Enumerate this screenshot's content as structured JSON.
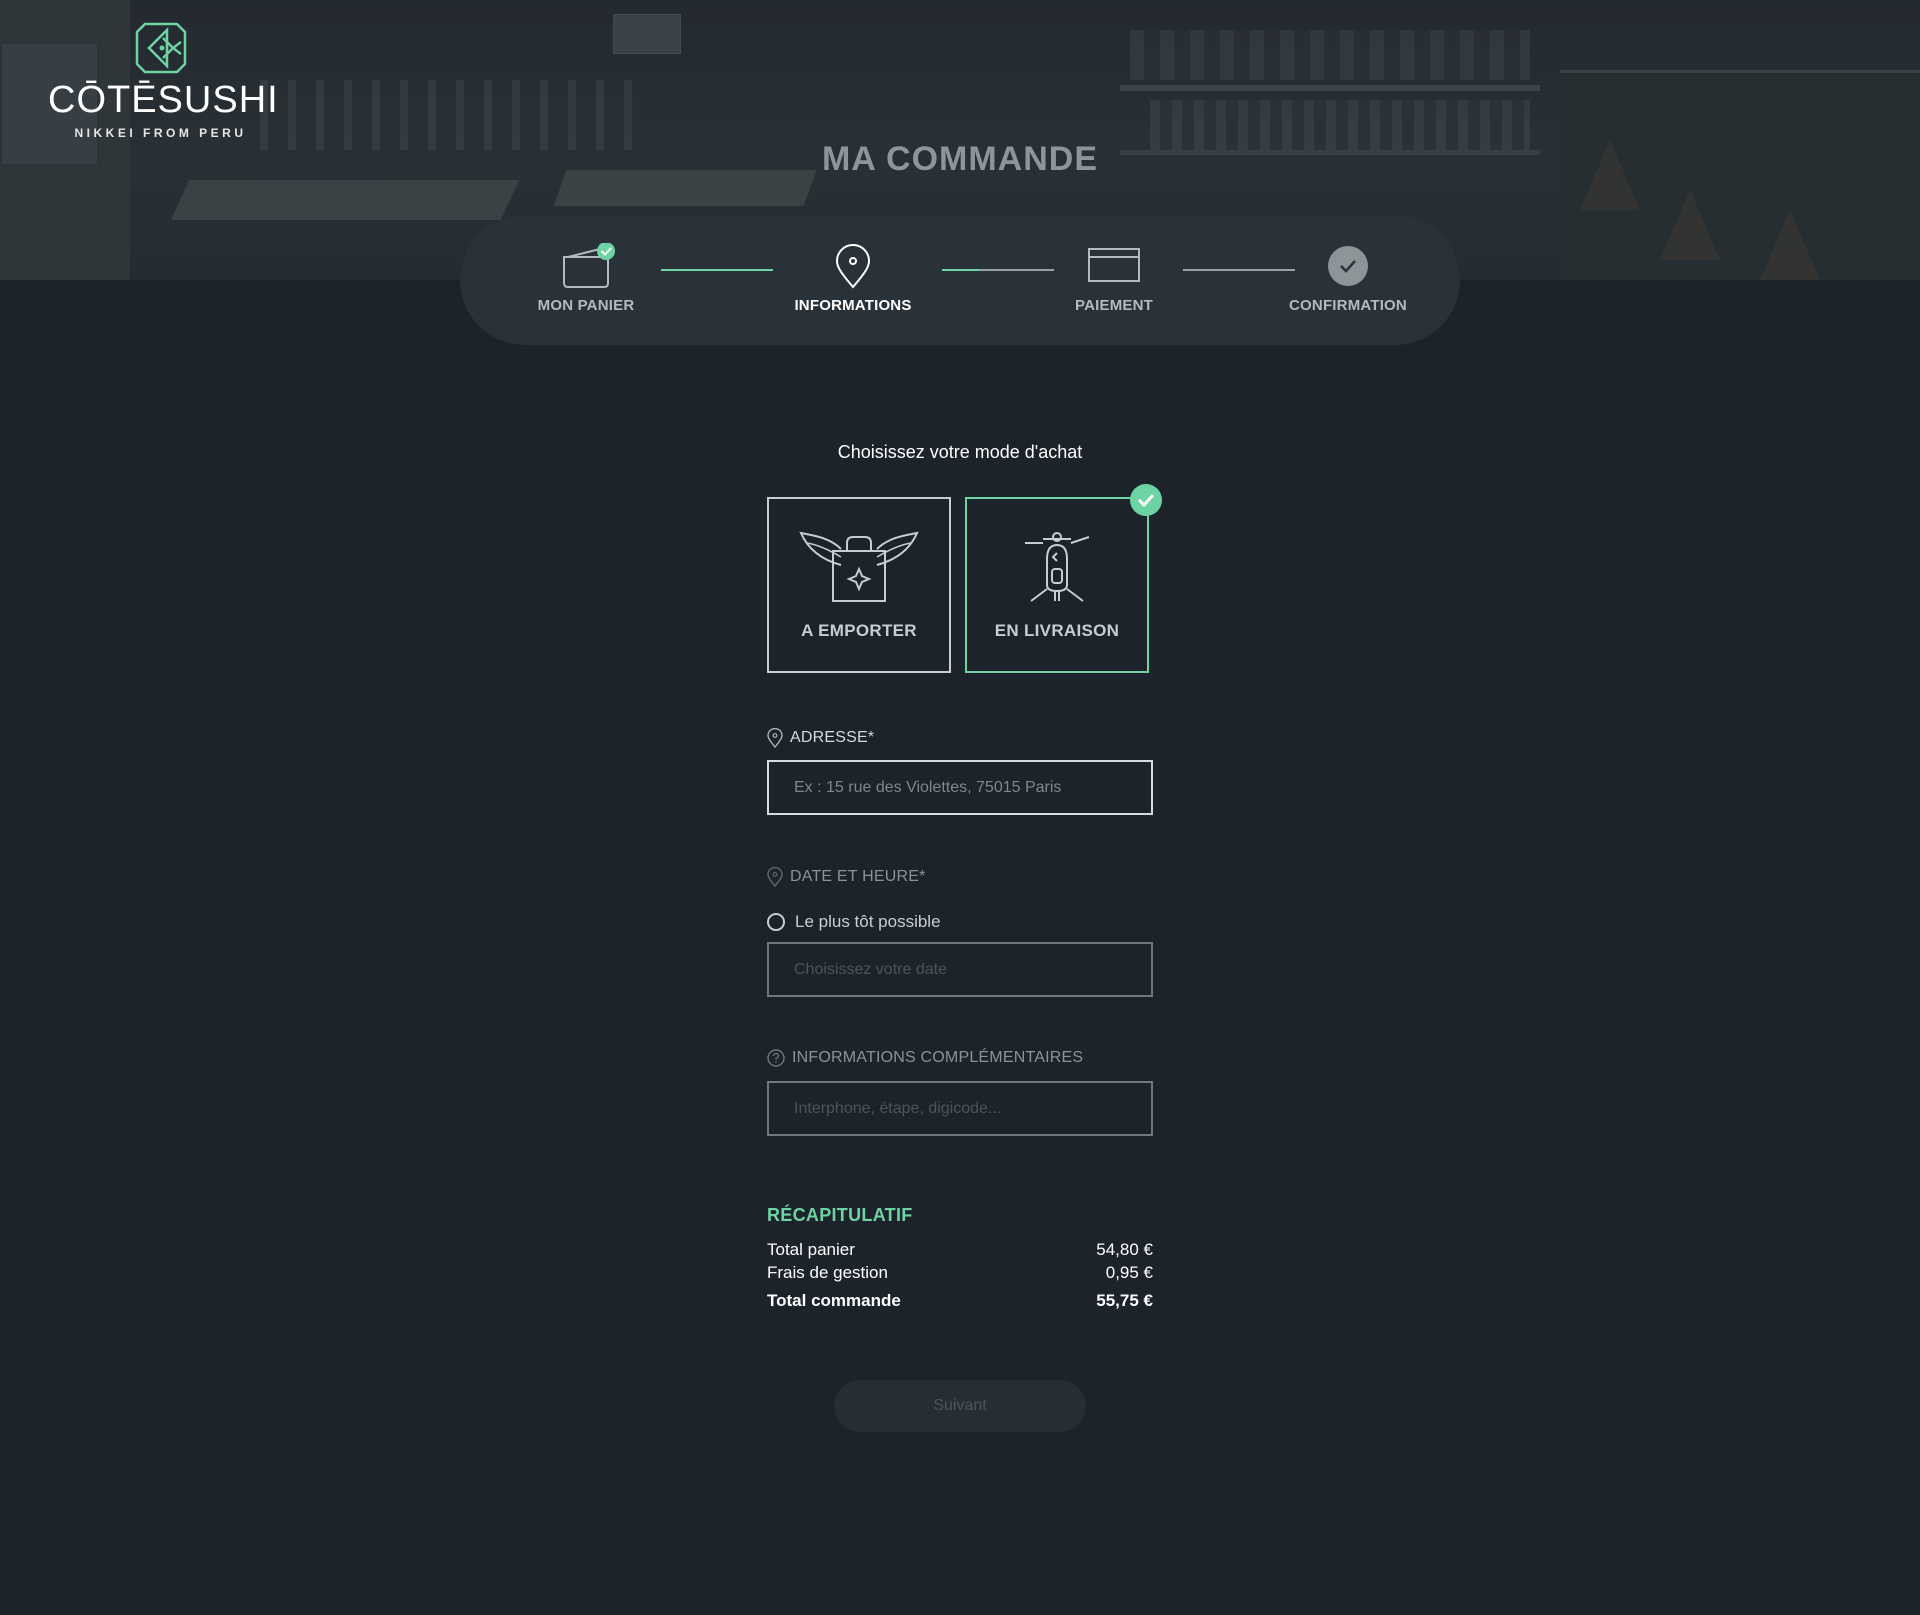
{
  "brand": {
    "name": "CŌTĒSUSHI",
    "tagline": "NIKKEI FROM PERU",
    "accent_color": "#6dd3a3"
  },
  "page": {
    "title": "MA COMMANDE"
  },
  "stepper": {
    "steps": [
      {
        "label": "MON PANIER",
        "icon": "basket-icon",
        "status": "done"
      },
      {
        "label": "INFORMATIONS",
        "icon": "location-pin-icon",
        "status": "active"
      },
      {
        "label": "PAIEMENT",
        "icon": "credit-card-icon",
        "status": "pending"
      },
      {
        "label": "CONFIRMATION",
        "icon": "check-circle-icon",
        "status": "pending"
      }
    ],
    "progress": [
      1.0,
      0.33,
      0.0
    ]
  },
  "mode": {
    "title": "Choisissez votre mode d'achat",
    "options": [
      {
        "label": "A EMPORTER",
        "icon": "winged-bag-icon",
        "selected": false
      },
      {
        "label": "EN LIVRAISON",
        "icon": "scooter-icon",
        "selected": true
      }
    ]
  },
  "form": {
    "address": {
      "label": "ADRESSE*",
      "placeholder": "Ex : 15 rue des Violettes, 75015 Paris",
      "value": ""
    },
    "datetime": {
      "label": "DATE ET HEURE*",
      "radio_label": "Le plus tôt possible",
      "placeholder": "Choisissez votre date",
      "value": ""
    },
    "extra": {
      "label": "INFORMATIONS COMPLÉMENTAIRES",
      "placeholder": "Interphone, étape, digicode...",
      "value": ""
    }
  },
  "recap": {
    "title": "RÉCAPITULATIF",
    "rows": [
      {
        "label": "Total panier",
        "value": "54,80 €"
      },
      {
        "label": "Frais de gestion",
        "value": "0,95 €"
      },
      {
        "label": "Total commande",
        "value": "55,75 €"
      }
    ]
  },
  "actions": {
    "next_label": "Suivant"
  }
}
